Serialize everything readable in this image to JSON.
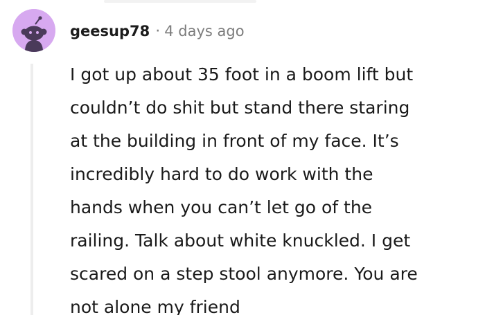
{
  "comment": {
    "username": "geesup78",
    "separator": "·",
    "timestamp": "4 days ago",
    "avatar_icon": "snoo-avatar-icon",
    "avatar_color": "#d7a9f0",
    "body_lines": [
      "I got up about 35 foot in a boom lift but",
      "couldn’t do shit but stand there staring",
      "at the building in front of my face. It’s",
      "incredibly hard to do work with the",
      "hands when you can’t let go of the",
      "railing. Talk about white knuckled. I get",
      "scared on a step stool anymore. You are",
      "not alone my friend"
    ]
  }
}
